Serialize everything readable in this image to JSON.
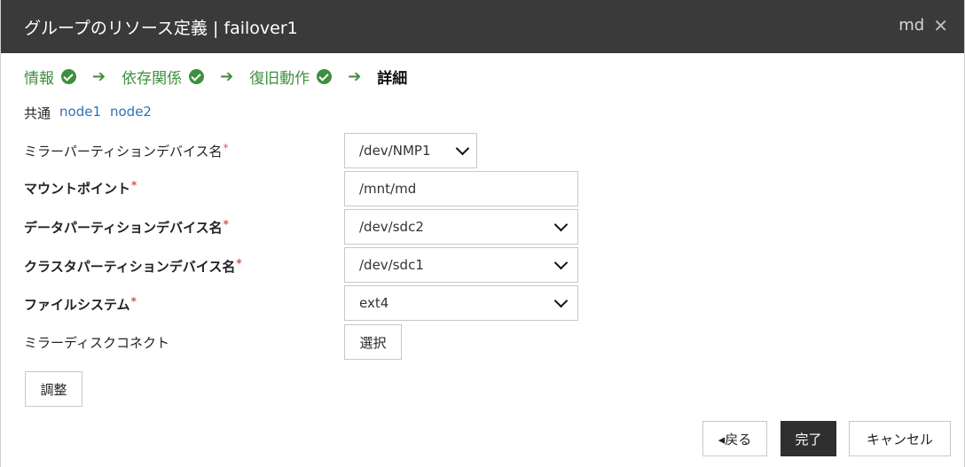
{
  "window": {
    "title": "グループのリソース定義 | failover1",
    "resource_name": "md",
    "close_icon": "close-icon"
  },
  "steps": [
    {
      "label": "情報",
      "done": true
    },
    {
      "label": "依存関係",
      "done": true
    },
    {
      "label": "復旧動作",
      "done": true
    },
    {
      "label": "詳細",
      "done": false
    }
  ],
  "tabs": {
    "common": "共通",
    "node1": "node1",
    "node2": "node2"
  },
  "fields": {
    "mirror_partition_device": {
      "label": "ミラーパーティションデバイス名",
      "value": "/dev/NMP1"
    },
    "mount_point": {
      "label": "マウントポイント",
      "value": "/mnt/md"
    },
    "data_partition_device": {
      "label": "データパーティションデバイス名",
      "value": "/dev/sdc2"
    },
    "cluster_partition_device": {
      "label": "クラスタパーティションデバイス名",
      "value": "/dev/sdc1"
    },
    "file_system": {
      "label": "ファイルシステム",
      "value": "ext4"
    },
    "mirror_disk_connect": {
      "label": "ミラーディスクコネクト",
      "button": "選択"
    }
  },
  "required_mark": "*",
  "buttons": {
    "tune": "調整",
    "back": "◂戻る",
    "finish": "完了",
    "cancel": "キャンセル"
  },
  "colors": {
    "titlebar": "#3a3a3a",
    "step_green": "#3f8f3f",
    "link_blue": "#2f73b5",
    "required_red": "#d9534f",
    "primary_button": "#2f2f2f"
  }
}
